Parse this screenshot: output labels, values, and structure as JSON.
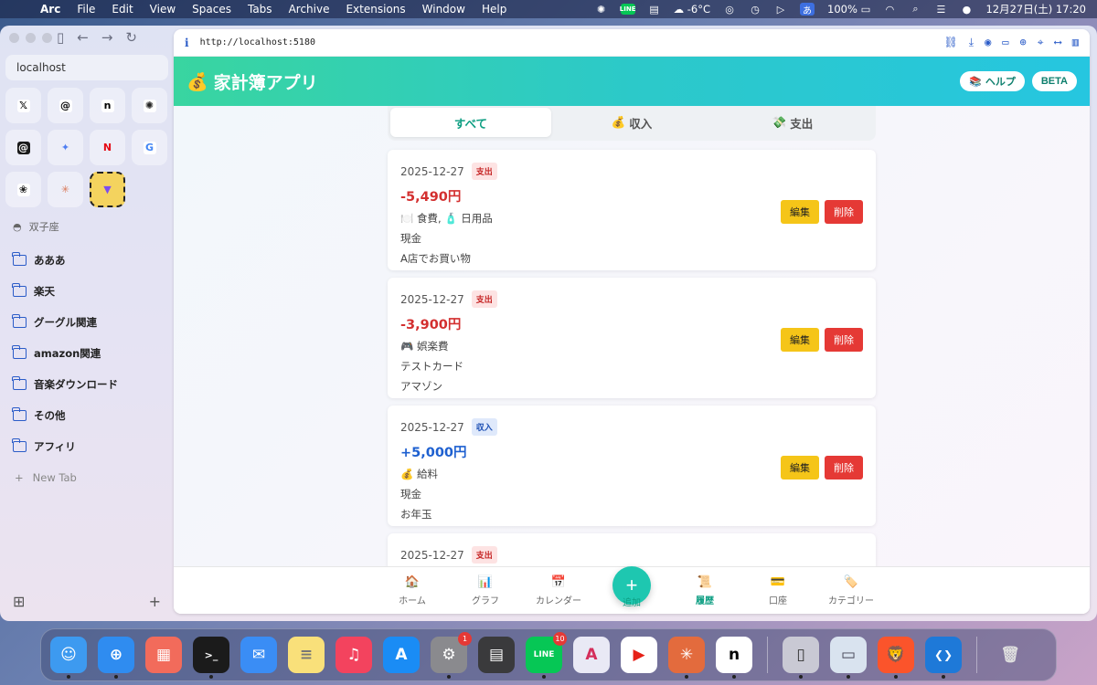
{
  "menubar": {
    "app": "Arc",
    "items": [
      "File",
      "Edit",
      "View",
      "Spaces",
      "Tabs",
      "Archive",
      "Extensions",
      "Window",
      "Help"
    ],
    "line_label": "LINE",
    "weather": "-6°C",
    "ime": "あ",
    "battery": "100%",
    "datetime": "12月27日(土)  17:20"
  },
  "sidebar": {
    "url": "localhost",
    "favorites": [
      {
        "name": "x-icon",
        "glyph": "𝕏",
        "bg": "#ffffff",
        "fg": "#000000"
      },
      {
        "name": "threads-icon",
        "glyph": "@",
        "bg": "#ffffff",
        "fg": "#000000"
      },
      {
        "name": "notion-icon",
        "glyph": "n",
        "bg": "#ffffff",
        "fg": "#000000"
      },
      {
        "name": "chatgpt-icon",
        "glyph": "✺",
        "bg": "#ffffff",
        "fg": "#222222"
      },
      {
        "name": "threads-color-icon",
        "glyph": "@",
        "bg": "#1a1a1a",
        "fg": "#ffffff"
      },
      {
        "name": "gemini-icon",
        "glyph": "✦",
        "bg": "transparent",
        "fg": "#4f7ef2"
      },
      {
        "name": "netflix-icon",
        "glyph": "N",
        "bg": "transparent",
        "fg": "#e50914"
      },
      {
        "name": "google-icon",
        "glyph": "G",
        "bg": "#ffffff",
        "fg": "#4285f4"
      },
      {
        "name": "openai-icon",
        "glyph": "❀",
        "bg": "#ffffff",
        "fg": "#222222"
      },
      {
        "name": "claude-icon",
        "glyph": "✳",
        "bg": "transparent",
        "fg": "#d97757"
      },
      {
        "name": "vite-icon",
        "glyph": "▼",
        "bg": "transparent",
        "fg": "#7b4df0"
      }
    ],
    "space_name": "双子座",
    "folders": [
      "あああ",
      "楽天",
      "グーグル関連",
      "amazon関連",
      "音楽ダウンロード",
      "その他",
      "アフィリ"
    ],
    "new_tab": "New Tab"
  },
  "browser": {
    "url": "http://localhost:5180"
  },
  "app": {
    "title": "家計簿アプリ",
    "help_label": "ヘルプ",
    "beta_label": "BETA",
    "tabs": [
      {
        "label": "すべて",
        "icon": ""
      },
      {
        "label": "収入",
        "icon": "💰"
      },
      {
        "label": "支出",
        "icon": "💸"
      }
    ],
    "transactions": [
      {
        "date": "2025-12-27",
        "type": "支出",
        "kind": "expense",
        "amount": "-5,490円",
        "category": "🍽️ 食費, 🧴 日用品",
        "account": "現金",
        "memo": "A店でお買い物"
      },
      {
        "date": "2025-12-27",
        "type": "支出",
        "kind": "expense",
        "amount": "-3,900円",
        "category": "🎮 娯楽費",
        "account": "テストカード",
        "memo": "アマゾン"
      },
      {
        "date": "2025-12-27",
        "type": "収入",
        "kind": "income",
        "amount": "+5,000円",
        "category": "💰 給料",
        "account": "現金",
        "memo": "お年玉"
      },
      {
        "date": "2025-12-27",
        "type": "支出",
        "kind": "expense",
        "amount": "",
        "category": "",
        "account": "",
        "memo": ""
      }
    ],
    "edit_label": "編集",
    "delete_label": "削除",
    "nav": [
      {
        "label": "ホーム",
        "icon": "🏠"
      },
      {
        "label": "グラフ",
        "icon": "📊"
      },
      {
        "label": "カレンダー",
        "icon": "📅"
      },
      {
        "label": "追加",
        "icon": "+"
      },
      {
        "label": "履歴",
        "icon": "📜"
      },
      {
        "label": "口座",
        "icon": "💳"
      },
      {
        "label": "カテゴリー",
        "icon": "🏷️"
      }
    ]
  },
  "dock": {
    "apps": [
      {
        "name": "finder-app",
        "glyph": "☺",
        "bg": "#3d9af0",
        "dot": true
      },
      {
        "name": "safari-app",
        "glyph": "⊕",
        "bg": "#2f8cf0",
        "dot": true
      },
      {
        "name": "launchpad-app",
        "glyph": "▦",
        "bg": "#f26b5b",
        "dot": false
      },
      {
        "name": "terminal-app",
        "glyph": ">_",
        "bg": "#1b1b1b",
        "dot": true
      },
      {
        "name": "mail-app",
        "glyph": "✉",
        "bg": "#3a8df5",
        "dot": false
      },
      {
        "name": "notes-app",
        "glyph": "≡",
        "bg": "#f9e07a",
        "dot": false
      },
      {
        "name": "music-app",
        "glyph": "♫",
        "bg": "#f3435e",
        "dot": false
      },
      {
        "name": "appstore-app",
        "glyph": "A",
        "bg": "#1a8cf5",
        "dot": false
      },
      {
        "name": "settings-app",
        "glyph": "⚙",
        "bg": "#8a8a8e",
        "dot": true,
        "badge": "1"
      },
      {
        "name": "calculator-app",
        "glyph": "▤",
        "bg": "#3a3a3c",
        "dot": false
      },
      {
        "name": "line-app",
        "glyph": "LINE",
        "bg": "#06c755",
        "dot": true,
        "badge": "10"
      },
      {
        "name": "a-app",
        "glyph": "A",
        "bg": "#e9e9f5",
        "dot": false
      },
      {
        "name": "youtube-app",
        "glyph": "▶",
        "bg": "#ffffff",
        "dot": false
      },
      {
        "name": "claude-app",
        "glyph": "✳",
        "bg": "#e36b3d",
        "dot": true
      },
      {
        "name": "notion-app",
        "glyph": "n",
        "bg": "#ffffff",
        "dot": true
      },
      {
        "name": "iphone-mirroring-app",
        "glyph": "▯",
        "bg": "#c9c9d4",
        "dot": true
      },
      {
        "name": "preview-app",
        "glyph": "▭",
        "bg": "#d9e3ef",
        "dot": true
      },
      {
        "name": "brave-app",
        "glyph": "🦁",
        "bg": "#fb542b",
        "dot": true
      },
      {
        "name": "vscode-app",
        "glyph": "❮❯",
        "bg": "#1e79d8",
        "dot": true
      },
      {
        "name": "trash-app",
        "glyph": "🗑",
        "bg": "transparent",
        "dot": false
      }
    ]
  }
}
